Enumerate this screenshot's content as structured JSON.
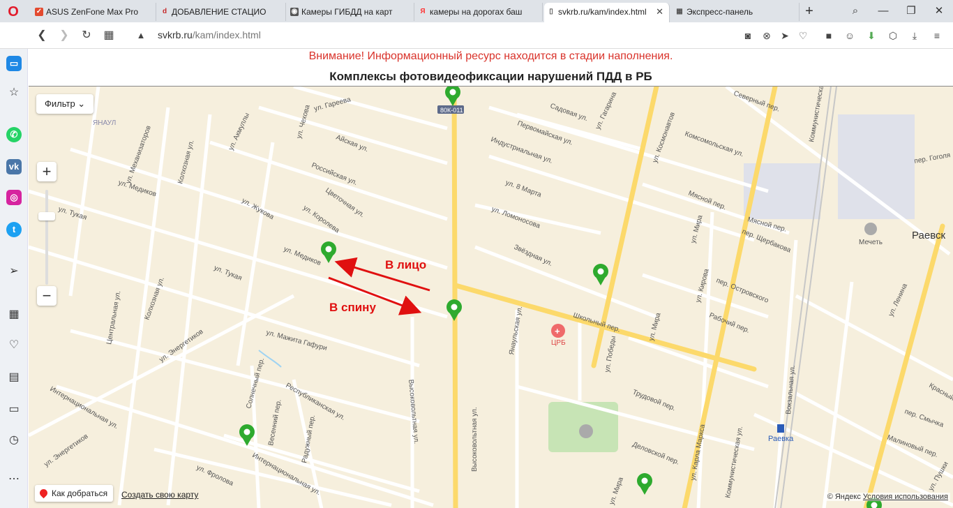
{
  "browser": {
    "tabs": [
      {
        "label": "ASUS ZenFone Max Pro",
        "icon": "asus-favicon",
        "color": "#e34a2f"
      },
      {
        "label": "ДОБАВЛЕНИЕ СТАЦИО",
        "icon": "drive2-favicon",
        "color": "#c62828"
      },
      {
        "label": "Камеры ГИБДД на карт",
        "icon": "camera-favicon",
        "color": "#555555"
      },
      {
        "label": "камеры на дорогах баш",
        "icon": "yandex-favicon",
        "color": "#f33"
      },
      {
        "label": "svkrb.ru/kam/index.html",
        "icon": "page-favicon",
        "color": "#555555"
      },
      {
        "label": "Экспресс-панель",
        "icon": "speed-dial-favicon",
        "color": "#555555"
      }
    ],
    "url_host": "svkrb.ru",
    "url_path": "/kam/index.html"
  },
  "page": {
    "notice": "Внимание! Информационный ресурс находится в стадии наполнения.",
    "title": "Комплексы фотовидеофиксации нарушений ПДД в РБ"
  },
  "map": {
    "filter_label": "Фильтр",
    "zoom_in": "+",
    "zoom_out": "−",
    "route_label": "Как добраться",
    "create_map_label": "Создать свою карту",
    "copyright": "© Яндекс",
    "terms": "Условия использования",
    "annotation_face": "В лицо",
    "annotation_back": "В спину",
    "streets": {
      "gareeva": "ул. Гареева",
      "chekhova": "ул. Чехова",
      "aiskaya": "Айская ул.",
      "rossiyskaya": "Российская ул.",
      "tsvetochnaya": "Цветочная ул.",
      "korolyova": "ул. Королева",
      "zhukova": "ул. Жукова",
      "medikov1": "ул. Медиков",
      "medikov2": "ул. Медиков",
      "tukaya1": "ул. Тукая",
      "tukaya2": "ул. Тукая",
      "akmully": "ул. Акмуллы",
      "mekhanizatorov": "ул. Механизаторов",
      "kolkhoznaya1": "Колхозная ул.",
      "kolkhoznaya2": "Колхозная ул.",
      "tsentralnaya": "Центральная ул.",
      "energetikov1": "ул. Энергетиков",
      "energetikov2": "ул. Энергетиков",
      "gafuri": "ул. Мажита Гафури",
      "internatsionalnaya1": "Интернациональная ул.",
      "internatsionalnaya2": "Интернациональная ул.",
      "frolova": "ул. Фролова",
      "solnechny": "Солнечный пер.",
      "vesenniy": "Весенний пер.",
      "respublikanskaya": "Республиканская ул.",
      "raduzhny": "Радужный пер.",
      "vysokovoltnaya1": "Высоковольтная ул.",
      "vysokovoltnaya2": "Высоковольтная ул.",
      "sadovaya": "Садовая ул.",
      "pervomayskaya": "Первомайская ул.",
      "industrialnaya": "Индустриальная ул.",
      "marta": "ул. 8 Марта",
      "lomonosova": "ул. Ломоносова",
      "zvyozdnaya": "Звёздная ул.",
      "gagarina": "ул. Гагарина",
      "kosmonavtov": "ул. Космонавтов",
      "komsomolskaya": "Комсомольская ул.",
      "severny": "Северный пер.",
      "myasnoy": "Мясной пер.",
      "myasnoy2": "Мясной пер.",
      "mira1": "ул. Мира",
      "mira2": "ул. Мира",
      "shcherbakova": "пер. Щербакова",
      "ostrovskogo": "пер. Островского",
      "kirova": "ул. Кирова",
      "rabochiy": "Рабочий пер.",
      "shkolny": "Школьный пер.",
      "yanaulskaya": "Янаульская ул.",
      "pobedy": "ул. Победы",
      "trudovoy": "Трудовой пер.",
      "delovskoy": "Деловской пер.",
      "karla_marksa": "ул. Карла Маркса",
      "kommunisticheskaya1": "Коммунистическая ул.",
      "kommunisticheskaya2": "Коммунистическая ул.",
      "vokzalnaya": "Вокзальная ул.",
      "lenina": "ул. Ленина",
      "gogolya": "пер. Гоголя",
      "smychka": "пер. Смычка",
      "malinovy": "Малиновый пер.",
      "krasny": "Красный",
      "pushkina": "ул. Пушки",
      "mira3": "ул. Мира"
    },
    "places": {
      "yanaul": "ЯНАУЛ",
      "crb": "ЦРБ",
      "mosque": "Мечеть",
      "raevsk": "Раевск",
      "raevka": "Раевка",
      "road_badge": "80К-011"
    },
    "colors": {
      "background": "#f6efdd",
      "major_road": "#fcd96b",
      "minor_road": "#ffffff",
      "marker": "#2eaa2e",
      "arrow": "#e01010"
    }
  }
}
